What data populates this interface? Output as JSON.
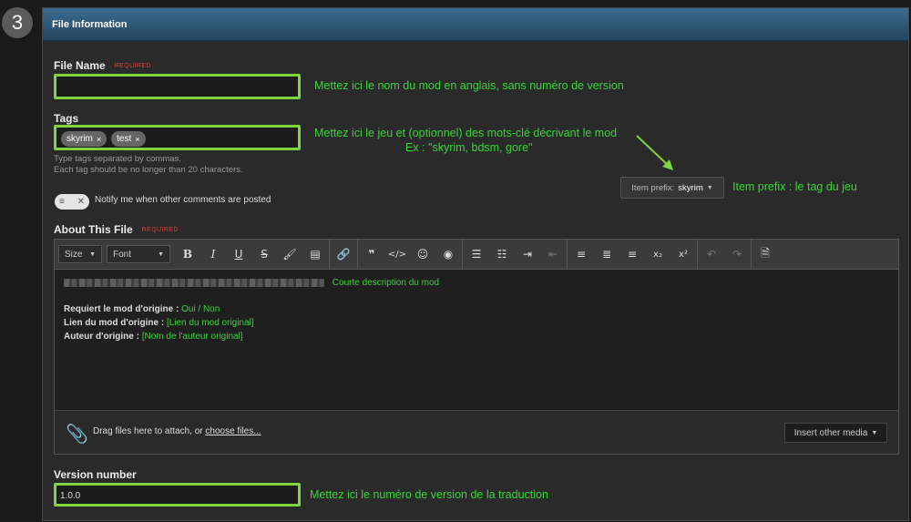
{
  "step": {
    "number": "3"
  },
  "panel": {
    "title": "File Information"
  },
  "file_name": {
    "label": "File Name",
    "required": "REQUIRED",
    "value": "",
    "annotation": "Mettez ici le nom du mod en anglais, sans numéro de version"
  },
  "tags": {
    "label": "Tags",
    "items": [
      {
        "text": "skyrim"
      },
      {
        "text": "test"
      }
    ],
    "remove_glyph": "×",
    "hint_line1": "Type tags separated by commas.",
    "hint_line2": "Each tag should be no longer than 20 characters.",
    "annotation_line1": "Mettez ici le jeu et (optionnel) des mots-clé décrivant le mod",
    "annotation_line2": "Ex : \"skyrim, bdsm, gore\""
  },
  "notify": {
    "label": "Notify me when other comments are posted"
  },
  "prefix": {
    "label": "Item prefix:",
    "value": "skyrim",
    "annotation": "Item prefix : le tag du jeu"
  },
  "about": {
    "label": "About This File",
    "required": "REQUIRED",
    "toolbar": {
      "size_label": "Size",
      "font_label": "Font"
    },
    "short_desc": "Courte description du mod",
    "lines": [
      {
        "key": "Requiert le mod d'origine :",
        "value": "Oui / Non"
      },
      {
        "key": "Lien du mod d'origine :",
        "value": "[Lien du mod original]"
      },
      {
        "key": "Auteur d'origine :",
        "value": "[Nom de l'auteur original]"
      }
    ],
    "attach_text": "Drag files here to attach, or",
    "attach_link": "choose files...",
    "insert_media": "Insert other media"
  },
  "version": {
    "label": "Version number",
    "value": "1.0.0",
    "annotation": "Mettez ici le numéro de version de la traduction"
  },
  "colors": {
    "highlight": "#7fd53b",
    "annotation": "#3ad43a",
    "header": "#2e5677"
  }
}
